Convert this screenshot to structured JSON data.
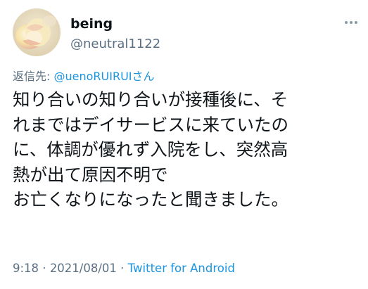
{
  "author": {
    "display_name": "being",
    "handle": "@neutral1122",
    "avatar_icon": "rose-avatar-icon"
  },
  "more_icon": "ellipsis-icon",
  "reply": {
    "prefix": "返信先: ",
    "mention": "@uenoRUIRUIさん"
  },
  "tweet_lines": [
    "知り合いの知り合いが接種後に、そ",
    "れまではデイサービスに来ていたの",
    "に、体調が優れず入院をし、突然高",
    "熱が出て原因不明で",
    "お亡くなりになったと聞きました。"
  ],
  "meta": {
    "time": "9:18",
    "separator": " · ",
    "date": "2021/08/01",
    "separator2": " · ",
    "source": "Twitter for Android"
  },
  "colors": {
    "text": "#0f1419",
    "secondary": "#5b7083",
    "link": "#1b95e0"
  }
}
